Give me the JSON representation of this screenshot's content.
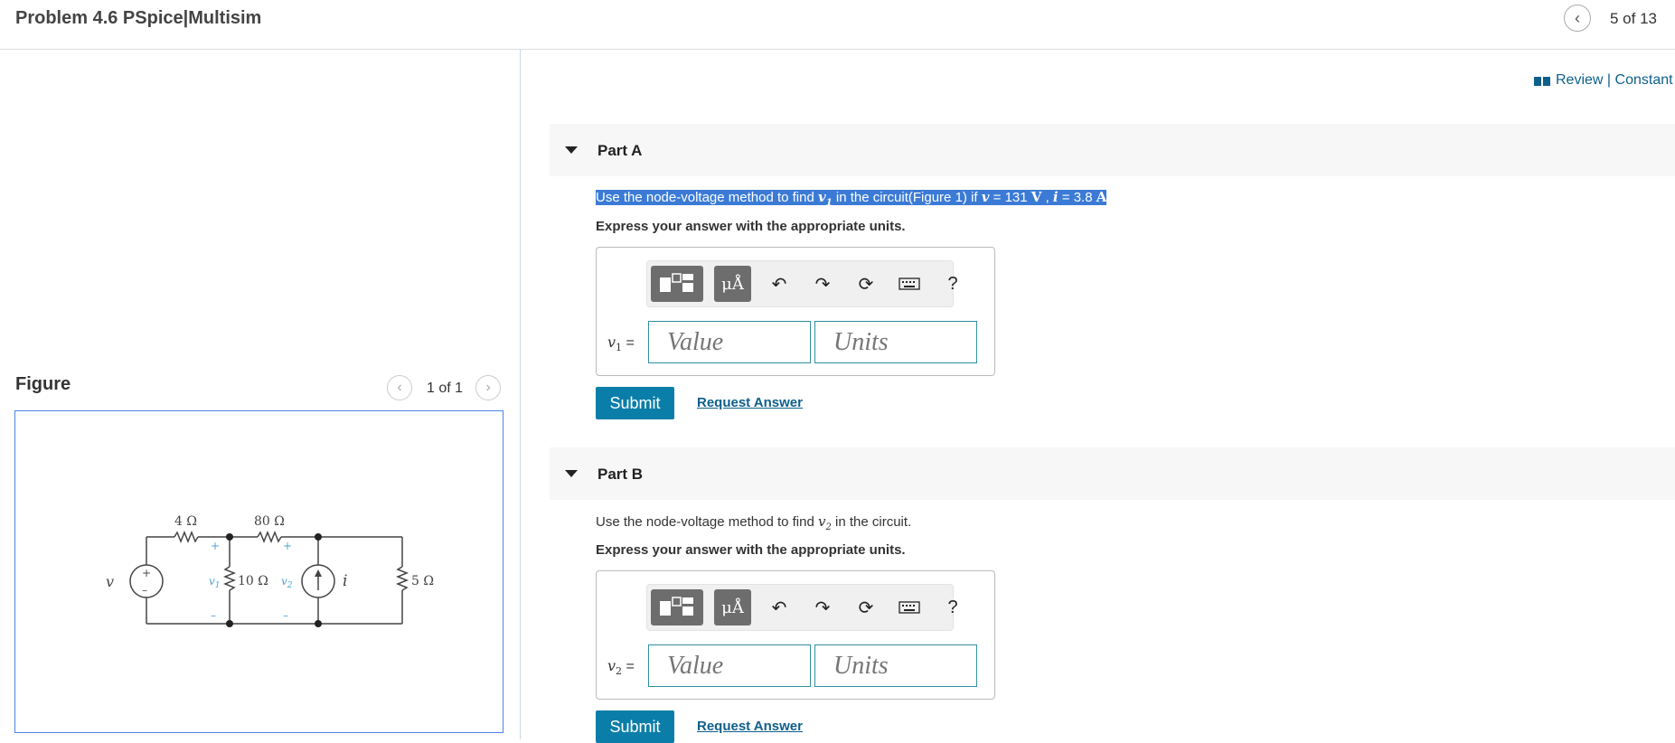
{
  "header": {
    "title": "Problem 4.6 PSpice|Multisim",
    "prev_icon": "chevron-left-icon",
    "problem_count": "5 of 13"
  },
  "figure_panel": {
    "label": "Figure",
    "count": "1 of 1",
    "circuit": {
      "source_label": "v",
      "plus": "+",
      "minus": "–",
      "r1": "4 Ω",
      "r2": "80 Ω",
      "r3": "10 Ω",
      "r4": "5 Ω",
      "v1": "v",
      "v1_sub": "1",
      "v2": "v",
      "v2_sub": "2",
      "current_label": "i"
    }
  },
  "links": {
    "review": "Review",
    "separator": "|",
    "constants": "Constant"
  },
  "partA": {
    "title": "Part A",
    "q1": "Use the node-voltage method to find ",
    "q_var": "v",
    "q_sub": "1",
    "q2": " in the circuit(Figure 1) if ",
    "q_v": "v",
    "q3": " = 131 ",
    "q_unitV": "V",
    "q4": " , ",
    "q_i": "i",
    "q5": " = 3.8 ",
    "q_unitA": "A",
    "express": "Express your answer with the appropriate units.",
    "var_label": "v",
    "var_sub": "1",
    "eq": " =",
    "value_placeholder": "Value",
    "units_placeholder": "Units",
    "submit": "Submit",
    "request": "Request Answer"
  },
  "partB": {
    "title": "Part B",
    "q1": "Use the node-voltage method to find ",
    "q_var": "v",
    "q_sub": "2",
    "q2": " in the circuit.",
    "express": "Express your answer with the appropriate units.",
    "var_label": "v",
    "var_sub": "2",
    "eq": " =",
    "value_placeholder": "Value",
    "units_placeholder": "Units",
    "submit": "Submit",
    "request": "Request Answer"
  },
  "toolbar": {
    "templates_icon": "templates-icon",
    "units_label": "μÅ",
    "undo_icon": "undo-icon",
    "redo_icon": "redo-icon",
    "reset_icon": "reset-icon",
    "keyboard_icon": "keyboard-icon",
    "help": "?"
  },
  "colors": {
    "accent": "#0a7ea8",
    "link": "#0e5f8c",
    "highlight": "#3b7bd6",
    "figure_border": "#4a86e8"
  }
}
